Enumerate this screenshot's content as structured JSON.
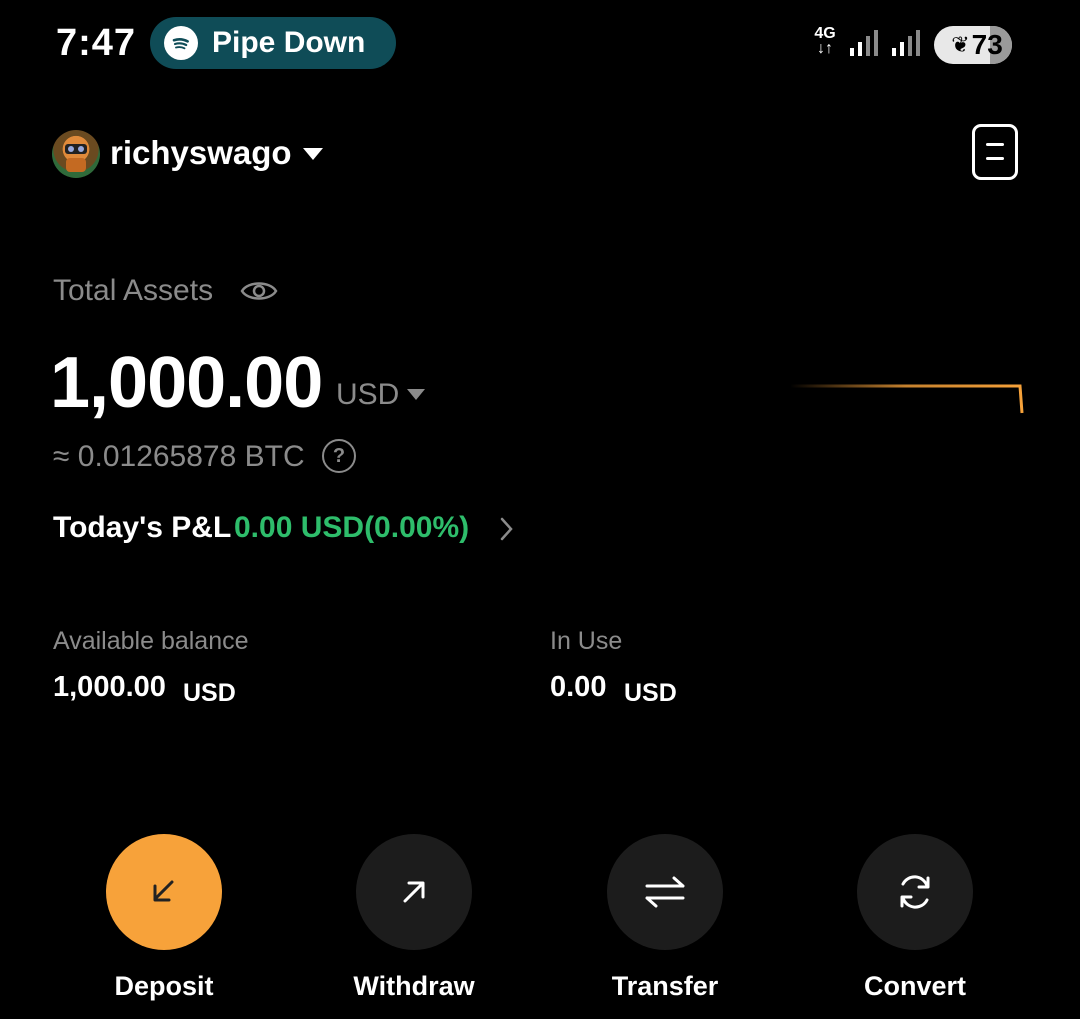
{
  "status_bar": {
    "time": "7:47",
    "media_label": "Pipe Down",
    "network": "4G",
    "battery": "73"
  },
  "account": {
    "username": "richyswago"
  },
  "assets": {
    "total_label": "Total Assets",
    "total_amount": "1,000.00",
    "currency": "USD",
    "btc_equivalent": "≈ 0.01265878 BTC",
    "pnl_label": "Today's P&L",
    "pnl_value": "0.00 USD(0.00%)"
  },
  "balances": {
    "available_label": "Available balance",
    "available_amount": "1,000.00",
    "available_currency": "USD",
    "in_use_label": "In Use",
    "in_use_amount": "0.00",
    "in_use_currency": "USD"
  },
  "actions": [
    {
      "label": "Deposit",
      "icon": "arrow-down-left-icon"
    },
    {
      "label": "Withdraw",
      "icon": "arrow-up-right-icon"
    },
    {
      "label": "Transfer",
      "icon": "swap-arrows-icon"
    },
    {
      "label": "Convert",
      "icon": "convert-cycle-icon"
    }
  ],
  "colors": {
    "accent": "#f7a23a",
    "positive": "#2ebd6b",
    "muted_text": "#8b8b8b",
    "media_pill": "#0f4c57"
  }
}
